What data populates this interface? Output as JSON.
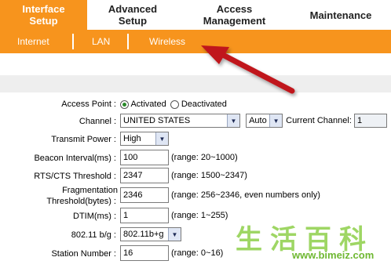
{
  "nav": {
    "tabs": [
      {
        "label": "Interface\nSetup",
        "line1": "Interface",
        "line2": "Setup"
      },
      {
        "label": "Advanced Setup",
        "line1": "Advanced",
        "line2": "Setup"
      },
      {
        "label": "Access Management",
        "line1": "Access",
        "line2": "Management"
      },
      {
        "label": "Maintenance"
      }
    ],
    "subtabs": [
      "Internet",
      "LAN",
      "Wireless"
    ]
  },
  "colors": {
    "accent": "#f7941d",
    "annotation_arrow": "#c0161b"
  },
  "form": {
    "access_point": {
      "label": "Access Point :",
      "opt_on": "Activated",
      "opt_off": "Deactivated",
      "selected": "Activated"
    },
    "channel": {
      "label": "Channel :",
      "value": "UNITED STATES",
      "mode": "Auto",
      "current_label": "Current Channel:",
      "current_value": "1"
    },
    "transmit_power": {
      "label": "Transmit Power :",
      "value": "High"
    },
    "beacon": {
      "label": "Beacon Interval(ms) :",
      "value": "100",
      "hint": "(range: 20~1000)"
    },
    "rts": {
      "label": "RTS/CTS Threshold :",
      "value": "2347",
      "hint": "(range: 1500~2347)"
    },
    "frag": {
      "label1": "Fragmentation",
      "label2": "Threshold(bytes) :",
      "value": "2346",
      "hint": "(range: 256~2346, even numbers only)"
    },
    "dtim": {
      "label": "DTIM(ms) :",
      "value": "1",
      "hint": "(range: 1~255)"
    },
    "mode": {
      "label": "802.11 b/g :",
      "value": "802.11b+g"
    },
    "station": {
      "label": "Station Number :",
      "value": "16",
      "hint": "(range: 0~16)"
    }
  },
  "watermark": {
    "chars": "生活百科",
    "url": "www.bimeiz.com"
  }
}
